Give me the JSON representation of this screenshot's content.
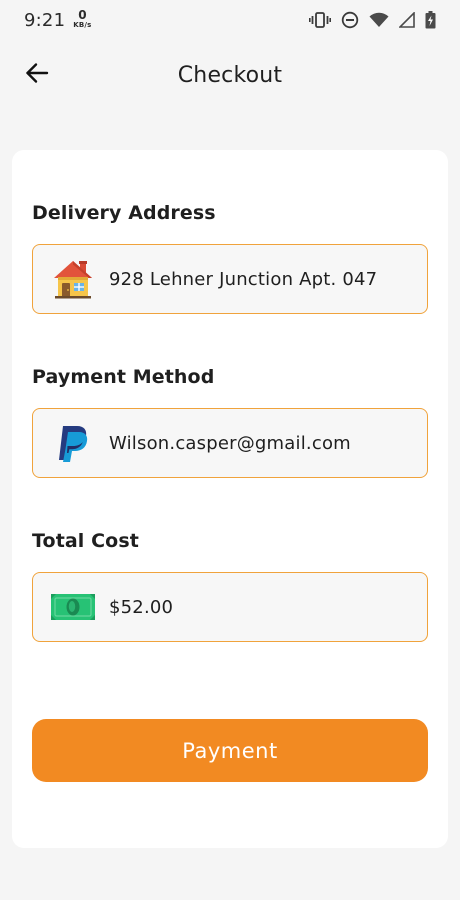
{
  "status_bar": {
    "time": "9:21",
    "net_speed_value": "0",
    "net_speed_unit": "KB/s",
    "icons": [
      "vibrate-icon",
      "do-not-disturb-icon",
      "wifi-icon",
      "signal-icon",
      "battery-charging-icon"
    ]
  },
  "header": {
    "title": "Checkout",
    "back_icon": "arrow-left-icon"
  },
  "delivery": {
    "label": "Delivery Address",
    "value": "928 Lehner Junction Apt. 047",
    "icon": "house-icon"
  },
  "payment_method": {
    "label": "Payment Method",
    "value": "Wilson.casper@gmail.com",
    "icon": "paypal-icon"
  },
  "total_cost": {
    "label": "Total Cost",
    "value": "$52.00",
    "icon": "banknote-icon"
  },
  "actions": {
    "payment_label": "Payment"
  },
  "colors": {
    "accent": "#f28a22",
    "field_border": "#f0a33c",
    "background": "#f5f5f5"
  }
}
